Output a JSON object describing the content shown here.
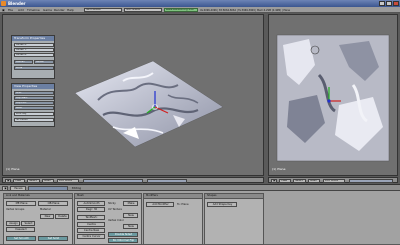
{
  "window": {
    "title": "Blender"
  },
  "menubar": {
    "items": [
      "File",
      "Add",
      "Timeline",
      "Game",
      "Render",
      "Help"
    ],
    "screen_select": "SR:2-Model",
    "scene_select": "SCE:Scene",
    "status": "www.blender.org 248",
    "stats": "Ve:4096-4096 | Ed:8064-8064 | Fa:3969-3969 | Mem:4.29M (0.46M) | Plane"
  },
  "viewport_left": {
    "corner_label": "(1) Plane",
    "header_buttons": [
      "View",
      "Select",
      "Mesh",
      "Edit Mode"
    ],
    "transform_panel": {
      "title": "Transform Properties",
      "fields": [
        "Vertex X:",
        "Vertex Y:",
        "Vertex Z:",
        "Median",
        "Global",
        "Local"
      ]
    },
    "view_panel": {
      "title": "View Properties",
      "fields": [
        "Grid:",
        "Clip Start:",
        "Clip End:",
        "Lens:",
        "Lock Obj",
        "3D Cursor"
      ]
    }
  },
  "viewport_right": {
    "corner_label": "(1) Plane",
    "header_buttons": [
      "View",
      "Select",
      "Mesh",
      "Edit Mode"
    ]
  },
  "buttons_window": {
    "header": [
      "Panels",
      "Editing"
    ],
    "link_panel": {
      "title": "Link and Materials",
      "fields": [
        "ME:Plane",
        "OB:Plane",
        "Vertex Groups",
        "Material",
        "New",
        "Delete",
        "Assign",
        "Select",
        "Deselect",
        "Set Smooth",
        "Set Solid"
      ]
    },
    "mesh_panel": {
      "title": "Mesh",
      "fields": [
        "AutoSmooth",
        "Degr: 30",
        "Sticky",
        "Make",
        "UV Texture",
        "New",
        "Vertex Color",
        "New",
        "TexMesh:",
        "Centre",
        "Centre New",
        "Centre Cursor",
        "Double Sided",
        "No V.Normal Flip"
      ]
    },
    "modifiers_panel": {
      "title": "Modifiers",
      "fields": [
        "Add Modifier",
        "To: Plane"
      ]
    },
    "shapes_panel": {
      "title": "Shapes",
      "fields": [
        "Add Shape Key"
      ]
    }
  },
  "colors": {
    "titlebar": "#4a66a0",
    "viewport_bg": "#707070",
    "mesh_light": "#d6d8e6",
    "axis_x": "#d02020",
    "axis_y": "#20b020",
    "axis_z": "#2030d0"
  }
}
